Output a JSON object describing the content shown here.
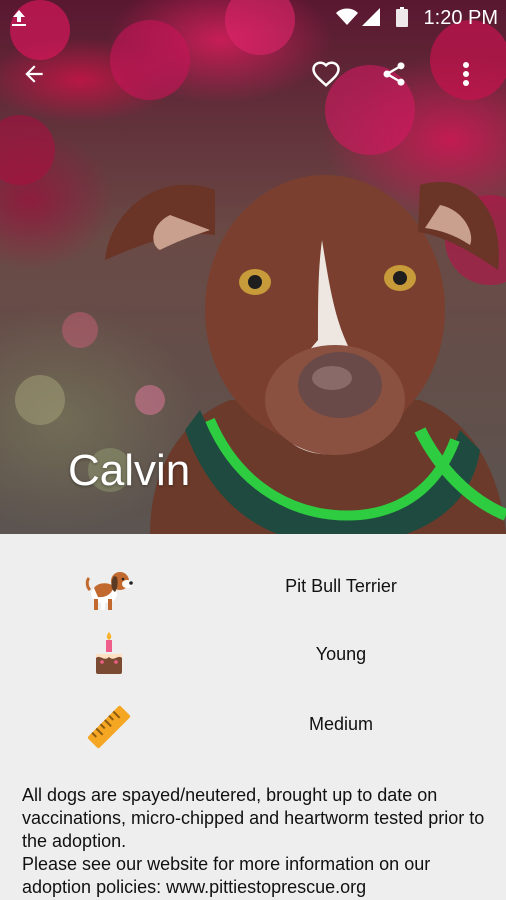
{
  "status_bar": {
    "time": "1:20 PM",
    "icons": [
      "upload-icon",
      "wifi-icon",
      "signal-icon",
      "battery-icon"
    ]
  },
  "toolbar": {
    "icons": [
      "back-arrow-icon",
      "heart-outline-icon",
      "share-icon",
      "more-vert-icon"
    ]
  },
  "pet": {
    "name": "Calvin",
    "photo_subject": "brown and white dog with green collar in front of pink flowers",
    "breed": "Pit Bull Terrier",
    "age": "Young",
    "size": "Medium",
    "attribute_icons": [
      "dog-emoji-icon",
      "birthday-cake-emoji-icon",
      "ruler-emoji-icon"
    ]
  },
  "description": {
    "line1": "All dogs are spayed/neutered, brought up to date on vaccinations, micro-chipped and heartworm tested prior to the adoption.",
    "line2": "Please see our website for more information on our adoption policies: www.pittiestoprescue.org"
  },
  "colors": {
    "background": "#eeeeee",
    "text": "#111111",
    "on_image": "#ffffff",
    "collar_green": "#2ecc40"
  }
}
